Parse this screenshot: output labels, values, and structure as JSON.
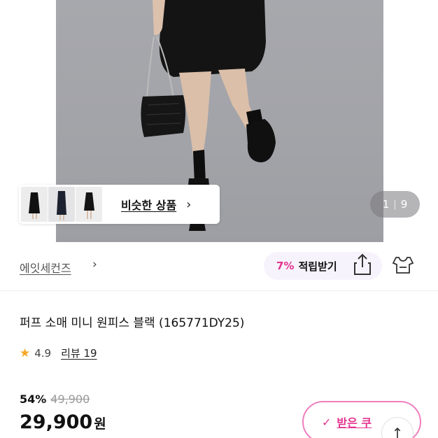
{
  "hero": {
    "similar_label": "비슷한 상품",
    "pager_current": "1",
    "pager_total": "9"
  },
  "brand": {
    "name": "에잇세컨즈",
    "points_pct": "7%",
    "points_text": "적립받기"
  },
  "product": {
    "title": "퍼프 소매 미니 원피스  블랙 (165771DY25)",
    "rating": "4.9",
    "review_label": "리뷰 19"
  },
  "price": {
    "discount": "54%",
    "original": "49,900",
    "current": "29,900",
    "currency": "원"
  },
  "coupon": {
    "label": "받은 쿠"
  },
  "colors": {
    "accent_pink": "#e3338f",
    "star": "#f5a623"
  }
}
